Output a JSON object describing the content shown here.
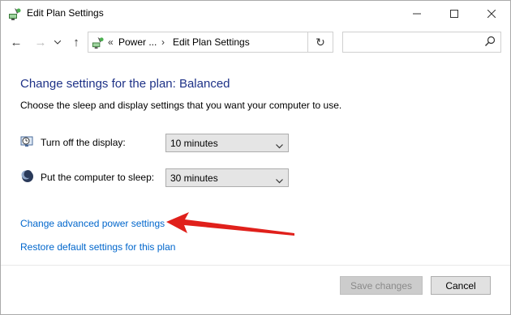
{
  "window": {
    "title": "Edit Plan Settings",
    "controls": {
      "minimize": "—",
      "maximize": "☐",
      "close": "✕"
    }
  },
  "nav": {
    "back": "←",
    "forward": "→",
    "recent": "⌄",
    "up": "↑",
    "breadcrumb_chevron": "«",
    "breadcrumb_1": "Power ...",
    "breadcrumb_sep": "›",
    "breadcrumb_2": "Edit Plan Settings",
    "refresh": "↻",
    "search_placeholder": ""
  },
  "main": {
    "heading": "Change settings for the plan: Balanced",
    "subtext": "Choose the sleep and display settings that you want your computer to use.",
    "display": {
      "label": "Turn off the display:",
      "value": "10 minutes"
    },
    "sleep": {
      "label": "Put the computer to sleep:",
      "value": "30 minutes"
    },
    "links": {
      "advanced": "Change advanced power settings",
      "restore": "Restore default settings for this plan"
    }
  },
  "footer": {
    "save_label": "Save changes",
    "cancel_label": "Cancel"
  },
  "colors": {
    "heading": "#1e3287",
    "link": "#0066cc",
    "annotation_arrow": "#e0201b"
  },
  "icons": {
    "title": "power-options-icon",
    "address": "power-options-icon",
    "display": "monitor-clock-icon",
    "sleep": "moon-icon",
    "search": "search-icon"
  }
}
